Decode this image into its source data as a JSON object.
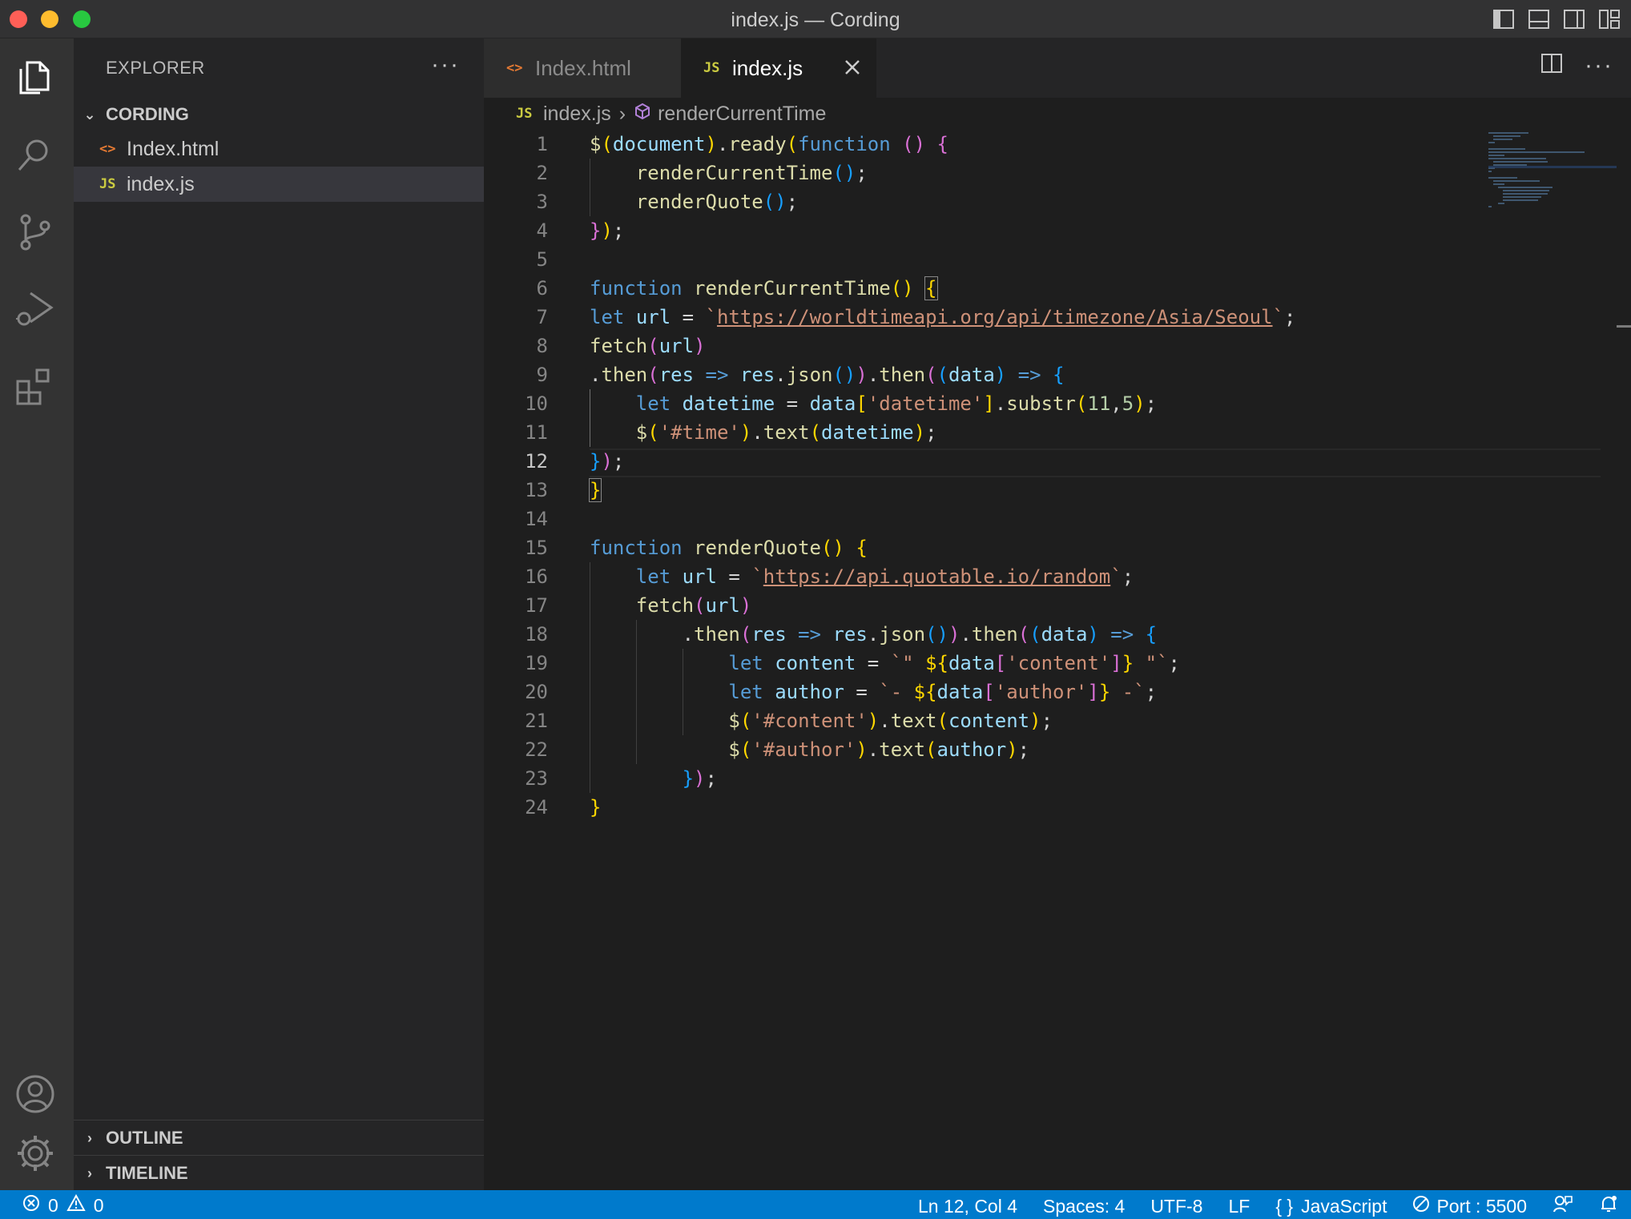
{
  "window": {
    "title": "index.js — Cording"
  },
  "explorer": {
    "header": "EXPLORER",
    "more": "···",
    "folder": "CORDING",
    "files": [
      {
        "name": "Index.html",
        "icon": "<>"
      },
      {
        "name": "index.js",
        "icon": "JS"
      }
    ],
    "outline": "OUTLINE",
    "timeline": "TIMELINE"
  },
  "tabs": [
    {
      "label": "Index.html",
      "icon": "<>"
    },
    {
      "label": "index.js",
      "icon": "JS"
    }
  ],
  "editor_actions": {
    "more": "···"
  },
  "breadcrumb": {
    "file": "index.js",
    "file_icon": "JS",
    "symbol": "renderCurrentTime"
  },
  "cursor_line": 12,
  "line_numbers": [
    "1",
    "2",
    "3",
    "4",
    "5",
    "6",
    "7",
    "8",
    "9",
    "10",
    "11",
    "12",
    "13",
    "14",
    "15",
    "16",
    "17",
    "18",
    "19",
    "20",
    "21",
    "22",
    "23",
    "24"
  ],
  "status": {
    "errors": "0",
    "warnings": "0",
    "position": "Ln 12, Col 4",
    "spaces": "Spaces: 4",
    "encoding": "UTF-8",
    "eol": "LF",
    "language": "JavaScript",
    "port": "Port : 5500"
  },
  "colors": {
    "statusbar": "#007acc",
    "activity_bar": "#333333",
    "sidebar": "#252526",
    "editor": "#1e1e1e"
  }
}
